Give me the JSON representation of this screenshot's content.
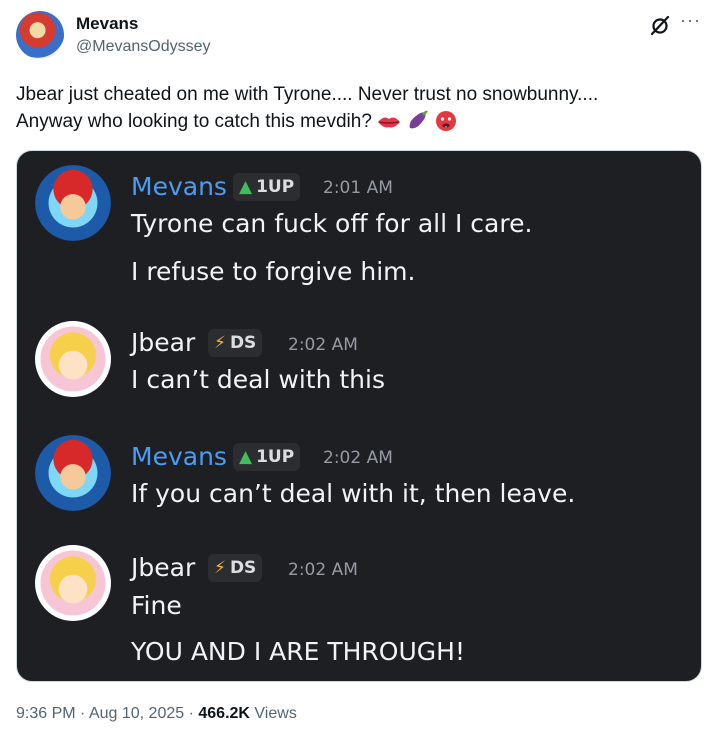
{
  "author": {
    "display_name": "Mevans",
    "handle": "@MevansOdyssey",
    "avatar_icon": "mario-avatar"
  },
  "header_icons": [
    "grok-icon",
    "more-options-icon"
  ],
  "tweet": {
    "line1": "Jbear just cheated on me with Tyrone.... Never trust no snowbunny....",
    "line2": "Anyway who looking to catch this mevdih?",
    "emojis": [
      "lips-emoji",
      "eggplant-emoji",
      "hot-face-emoji"
    ]
  },
  "chat": {
    "background": "#1e1f22",
    "messages": [
      {
        "author": "Mevans",
        "badge": "1UP",
        "badge_icon": "mushroom-icon",
        "time": "2:01 AM",
        "name_color": "#4b9cf5",
        "lines": [
          "Tyrone can fuck off for all I care.",
          "I refuse to forgive him."
        ]
      },
      {
        "author": "Jbear",
        "badge": "DS",
        "badge_icon": "lightning-icon",
        "time": "2:02 AM",
        "name_color": "#f2f3f5",
        "lines": [
          "I can’t deal with this"
        ]
      },
      {
        "author": "Mevans",
        "badge": "1UP",
        "badge_icon": "mushroom-icon",
        "time": "2:02 AM",
        "name_color": "#4b9cf5",
        "lines": [
          "If you can’t deal with it, then leave."
        ]
      },
      {
        "author": "Jbear",
        "badge": "DS",
        "badge_icon": "lightning-icon",
        "time": "2:02 AM",
        "name_color": "#f2f3f5",
        "lines": [
          "Fine",
          "YOU AND I ARE THROUGH!"
        ]
      }
    ]
  },
  "footer": {
    "time": "9:36 PM",
    "sep1": "·",
    "date": "Aug 10, 2025",
    "sep2": "·",
    "views_count": "466.2K",
    "views_label": "Views"
  }
}
